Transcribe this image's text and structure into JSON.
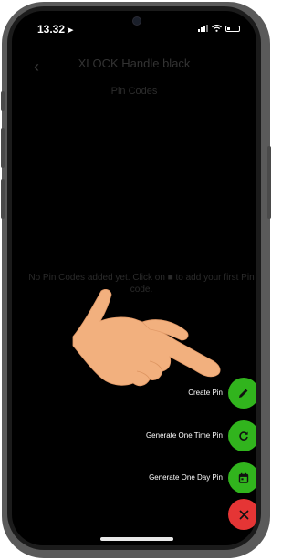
{
  "status_bar": {
    "time": "13.32"
  },
  "header": {
    "back_icon": "chevron-left-icon",
    "title": "XLOCK Handle black"
  },
  "page": {
    "subtitle": "Pin Codes",
    "empty_message": "No Pin Codes added yet. Click on ■ to add your first Pin code."
  },
  "fab_menu": {
    "items": [
      {
        "label": "Create Pin",
        "icon": "pencil-icon",
        "color": "#31b41d"
      },
      {
        "label": "Generate One Time Pin",
        "icon": "refresh-icon",
        "color": "#31b41d"
      },
      {
        "label": "Generate One Day Pin",
        "icon": "calendar-icon",
        "color": "#31b41d"
      }
    ],
    "close": {
      "icon": "close-icon",
      "color": "#e53535"
    }
  },
  "overlay": {
    "hand_icon": "pointing-hand-icon",
    "hand_color": "#f2b07e"
  },
  "colors": {
    "accent_green": "#31b41d",
    "accent_red": "#e53535",
    "background": "#000000"
  }
}
